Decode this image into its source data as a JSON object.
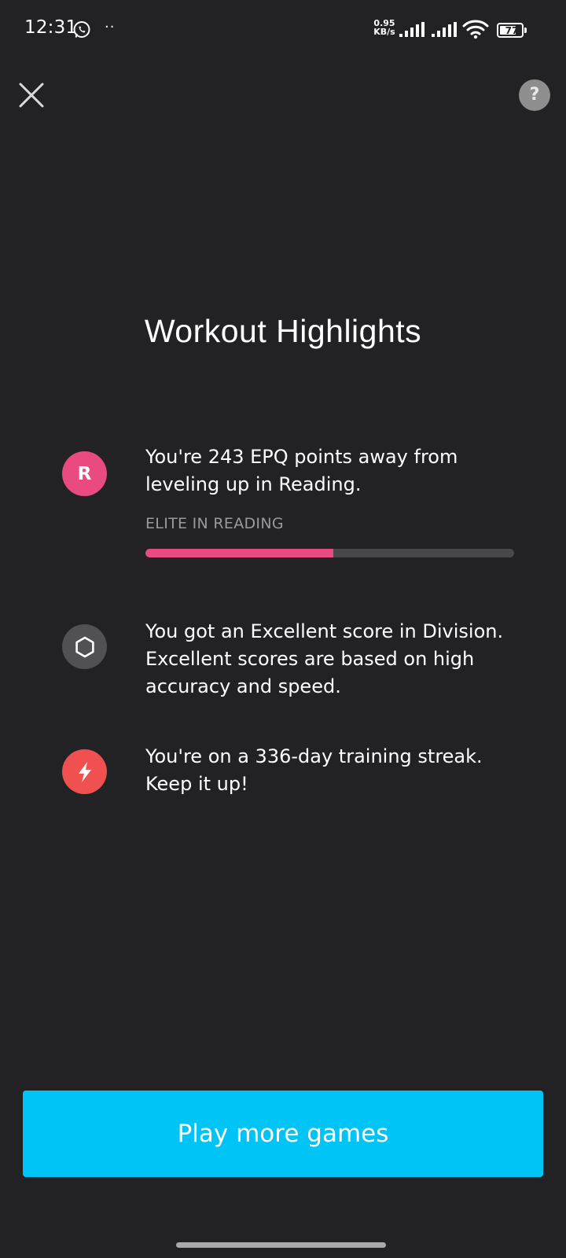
{
  "status_bar": {
    "time": "12:31",
    "dots": "··",
    "net_speed_value": "0.95",
    "net_speed_unit": "KB/s",
    "battery": "77",
    "battery_level": 0.77,
    "icons": [
      "whatsapp-icon",
      "signal-icon",
      "signal-icon",
      "wifi-icon",
      "battery-icon"
    ]
  },
  "header": {
    "close_icon": "close-icon",
    "help_label": "?"
  },
  "title": "Workout Highlights",
  "highlights": [
    {
      "icon_letter": "R",
      "icon_color": "#e94a7f",
      "text": "You're 243 EPQ points away from leveling up in Reading.",
      "level_label": "ELITE IN READING",
      "progress": 0.51
    },
    {
      "icon": "hexagon-icon",
      "icon_color": "#515154",
      "text": "You got an Excellent score in Division. Excellent scores are based on high accuracy and speed."
    },
    {
      "icon": "lightning-icon",
      "icon_color": "#f0504f",
      "text": "You're on a 336-day training streak. Keep it up!"
    }
  ],
  "cta": {
    "label": "Play more games",
    "color": "#00c3f6"
  }
}
